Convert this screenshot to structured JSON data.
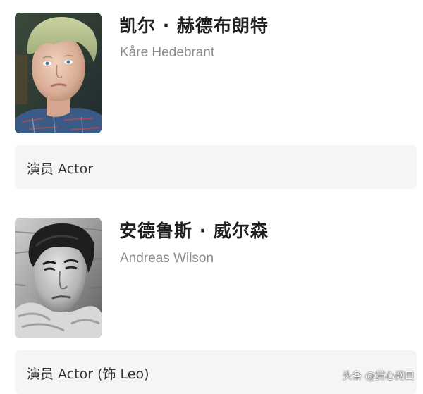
{
  "cast": [
    {
      "name_cn": "凯尔 · 赫德布朗特",
      "name_en": "Kåre Hedebrant",
      "role": "演员 Actor",
      "photo": "portrait-young-man-blonde"
    },
    {
      "name_cn": "安德鲁斯 · 威尔森",
      "name_en": "Andreas Wilson",
      "role": "演员 Actor (饰 Leo)",
      "photo": "portrait-man-dark-hair-bw"
    }
  ],
  "watermark": "头条 @赏心阅目"
}
